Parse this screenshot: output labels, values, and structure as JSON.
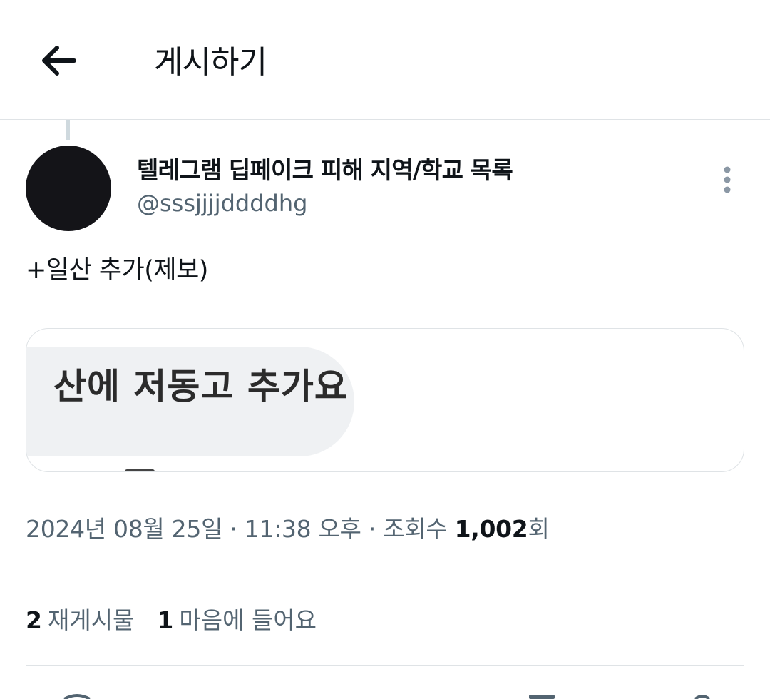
{
  "header": {
    "title": "게시하기"
  },
  "author": {
    "display_name": "텔레그램 딥페이크 피해 지역/학교 목록",
    "handle": "@sssjjjjddddhg"
  },
  "tweet": {
    "text": "+일산 추가(제보)",
    "image_text": "산에 저동고 추가요"
  },
  "meta": {
    "date": "2024년 08월 25일",
    "separator": " · ",
    "time": "11:38 오후",
    "views_label": "조회수 ",
    "views_count": "1,002",
    "views_suffix": "회"
  },
  "stats": {
    "retweets_count": "2",
    "retweets_label": "재게시물",
    "likes_count": "1",
    "likes_label": "마음에 들어요"
  },
  "colors": {
    "text": "#0f1419",
    "secondary": "#536471",
    "border": "#dfe3e6",
    "bubble": "#eff1f3"
  }
}
